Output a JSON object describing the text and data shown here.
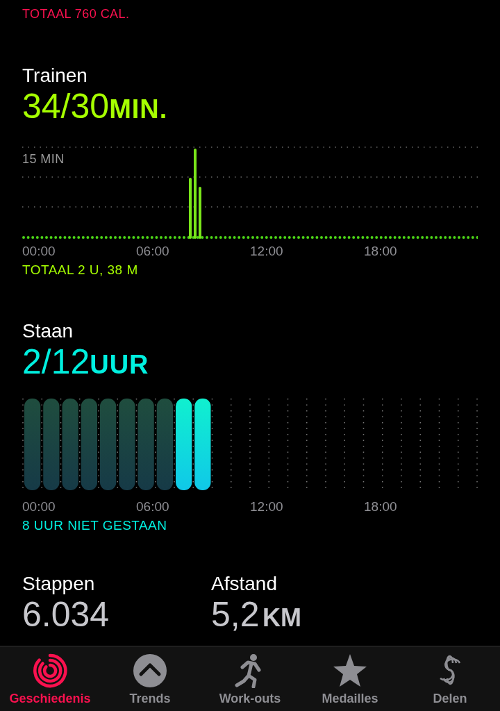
{
  "top_total": "TOTAAL 760 CAL.",
  "exercise": {
    "title": "Trainen",
    "value": "34/30",
    "unit": "MIN.",
    "chart_label": "15 MIN",
    "times": [
      "00:00",
      "06:00",
      "12:00",
      "18:00"
    ],
    "total": "TOTAAL 2 U, 38 M"
  },
  "stand": {
    "title": "Staan",
    "value": "2/12",
    "unit": "UUR",
    "hours": [
      {
        "stood": false
      },
      {
        "stood": false
      },
      {
        "stood": false
      },
      {
        "stood": false
      },
      {
        "stood": false
      },
      {
        "stood": false
      },
      {
        "stood": false
      },
      {
        "stood": false
      },
      {
        "stood": true
      },
      {
        "stood": true
      }
    ],
    "times": [
      "00:00",
      "06:00",
      "12:00",
      "18:00"
    ],
    "total": "8 UUR NIET GESTAAN"
  },
  "stats": [
    {
      "label": "Stappen",
      "value": "6.034"
    },
    {
      "label": "Afstand",
      "value": "5,2",
      "unit": "KM"
    }
  ],
  "tabs": [
    {
      "label": "Geschiedenis",
      "kind": "rings",
      "selected": true
    },
    {
      "label": "Trends",
      "kind": "trends",
      "selected": false
    },
    {
      "label": "Work-outs",
      "kind": "runner",
      "selected": false
    },
    {
      "label": "Medailles",
      "kind": "star",
      "selected": false
    },
    {
      "label": "Delen",
      "kind": "share",
      "selected": false
    }
  ]
}
